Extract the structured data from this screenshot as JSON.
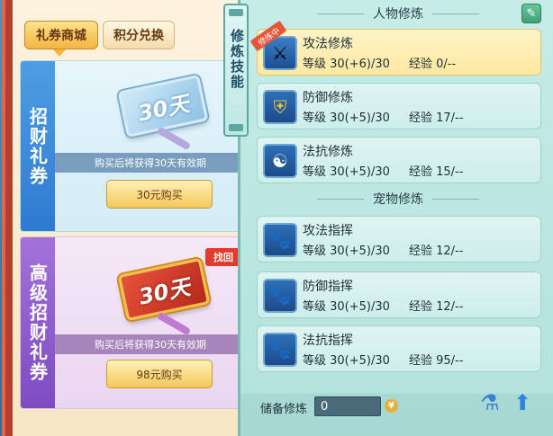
{
  "shop": {
    "tabs": [
      {
        "label": "礼券商城",
        "active": true
      },
      {
        "label": "积分兑换",
        "active": false
      }
    ],
    "cards": [
      {
        "side_label": "招财礼券",
        "ticket_text": "30天",
        "validity": "购买后将获得30天有效期",
        "button_label": "30元购买"
      },
      {
        "side_label": "高级招财礼券",
        "ticket_text": "30天",
        "validity": "购买后将获得30天有效期",
        "button_label": "98元购买",
        "corner_tag": "找回"
      }
    ]
  },
  "training": {
    "tab_label": "修炼技能",
    "character_title": "人物修炼",
    "pet_title": "宠物修炼",
    "character_skills": [
      {
        "name": "攻法修炼",
        "level": "等级 30(+6)/30",
        "exp": "经验 0/--",
        "badge": "修炼中",
        "selected": true,
        "icon": "sword-icon"
      },
      {
        "name": "防御修炼",
        "level": "等级 30(+5)/30",
        "exp": "经验 17/--",
        "selected": false,
        "icon": "shield-icon"
      },
      {
        "name": "法抗修炼",
        "level": "等级 30(+5)/30",
        "exp": "经验 15/--",
        "selected": false,
        "icon": "yin-yang-icon"
      }
    ],
    "pet_skills": [
      {
        "name": "攻法指挥",
        "level": "等级 30(+5)/30",
        "exp": "经验 12/--",
        "icon": "paw-attack-icon"
      },
      {
        "name": "防御指挥",
        "level": "等级 30(+5)/30",
        "exp": "经验 12/--",
        "icon": "paw-defense-icon"
      },
      {
        "name": "法抗指挥",
        "level": "等级 30(+5)/30",
        "exp": "经验 95/--",
        "icon": "paw-resist-icon"
      }
    ],
    "reserve_label": "储备修炼",
    "reserve_value": "0"
  }
}
